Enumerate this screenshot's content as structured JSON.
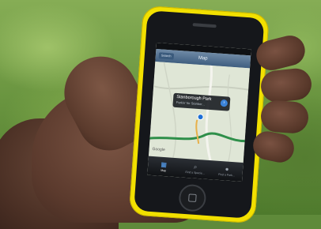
{
  "scene": {
    "description_colors": {
      "phone_case": "#f2e000",
      "nav_bar": "#3f5e80",
      "map_land": "#dfe6d6",
      "route_green": "#2f8f4a",
      "pin_blue": "#1e6fd6"
    }
  },
  "maps_app": {
    "nav_title": "Map",
    "nav_left_button": "Search",
    "callout_title": "Stanborough Park",
    "callout_subtitle": "Parkin’ for Stanbor...",
    "attribution": "Google",
    "tabs": [
      {
        "label": "Map",
        "icon": "map-icon"
      },
      {
        "label": "Find a Specie...",
        "icon": "search-icon"
      },
      {
        "label": "Find a Park...",
        "icon": "person-icon"
      }
    ]
  }
}
